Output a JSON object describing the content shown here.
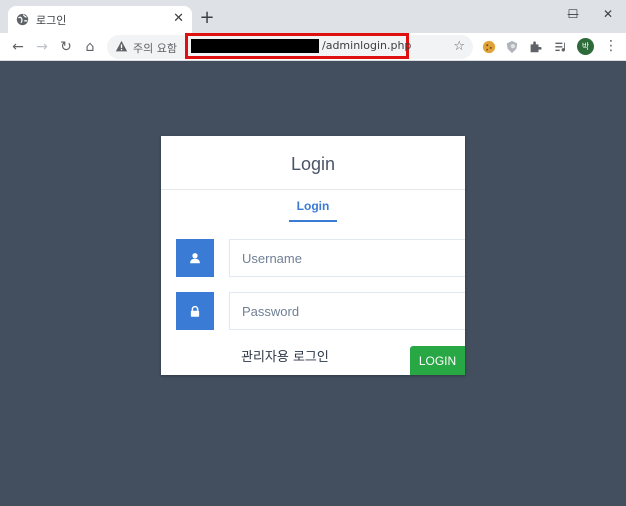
{
  "browser": {
    "tab": {
      "title": "로그인",
      "close": "✕",
      "favicon": "globe-icon"
    },
    "new_tab": "+",
    "window": {
      "minimize": "—",
      "maximize": "☐",
      "close": "✕"
    },
    "nav": {
      "back": "←",
      "forward": "→",
      "reload": "↻",
      "home": "⌂"
    },
    "omnibox": {
      "security_label": "주의 요함",
      "url_visible": "/adminlogin.php",
      "url_redacted": true
    },
    "bookmark": "☆",
    "profile_initial": "박",
    "menu": "⋮"
  },
  "colors": {
    "page_bg": "#434f5f",
    "accent": "#3a7bd5",
    "success": "#28a745",
    "highlight": "#e01010"
  },
  "card": {
    "title": "Login",
    "tabs": [
      {
        "label": "Login",
        "active": true
      }
    ],
    "username": {
      "placeholder": "Username",
      "value": "",
      "icon": "user-icon"
    },
    "password": {
      "placeholder": "Password",
      "value": "",
      "icon": "lock-icon"
    },
    "admin_label": "관리자용 로그인",
    "submit_label": "LOGIN"
  }
}
